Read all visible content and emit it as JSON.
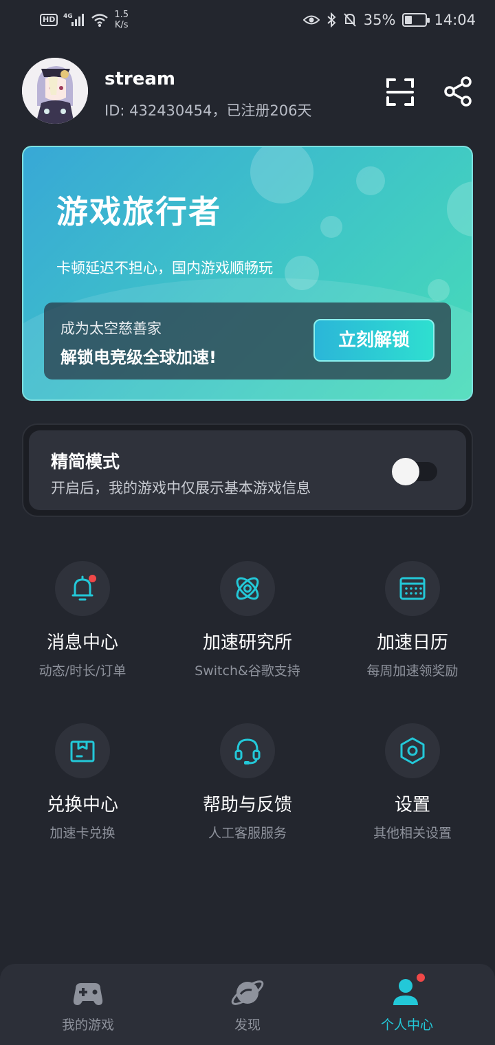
{
  "status_bar": {
    "network": "4G",
    "speed_value": "1.5",
    "speed_unit": "K/s",
    "battery": "35%",
    "time": "14:04",
    "hd_label": "HD"
  },
  "profile": {
    "username": "stream",
    "id_text": "ID: 432430454，已注册206天"
  },
  "banner": {
    "title": "游戏旅行者",
    "subtitle": "卡顿延迟不担心，国内游戏顺畅玩",
    "promo_line1": "成为太空慈善家",
    "promo_line2": "解锁电竞级全球加速!",
    "unlock_label": "立刻解锁"
  },
  "simple_mode": {
    "title": "精简模式",
    "description": "开启后，我的游戏中仅展示基本游戏信息",
    "enabled": false
  },
  "grid": [
    {
      "title": "消息中心",
      "subtitle": "动态/时长/订单",
      "icon": "bell-icon"
    },
    {
      "title": "加速研究所",
      "subtitle": "Switch&谷歌支持",
      "icon": "atom-icon"
    },
    {
      "title": "加速日历",
      "subtitle": "每周加速领奖励",
      "icon": "calendar-icon"
    },
    {
      "title": "兑换中心",
      "subtitle": "加速卡兑换",
      "icon": "gift-box-icon"
    },
    {
      "title": "帮助与反馈",
      "subtitle": "人工客服服务",
      "icon": "headset-icon"
    },
    {
      "title": "设置",
      "subtitle": "其他相关设置",
      "icon": "settings-hexagon-icon"
    }
  ],
  "bottom_nav": [
    {
      "label": "我的游戏",
      "icon": "gamepad-icon",
      "active": false
    },
    {
      "label": "发现",
      "icon": "planet-icon",
      "active": false
    },
    {
      "label": "个人中心",
      "icon": "user-icon",
      "active": true
    }
  ],
  "colors": {
    "background": "#23262e",
    "accent": "#23c8d8",
    "badge": "#f04848"
  }
}
